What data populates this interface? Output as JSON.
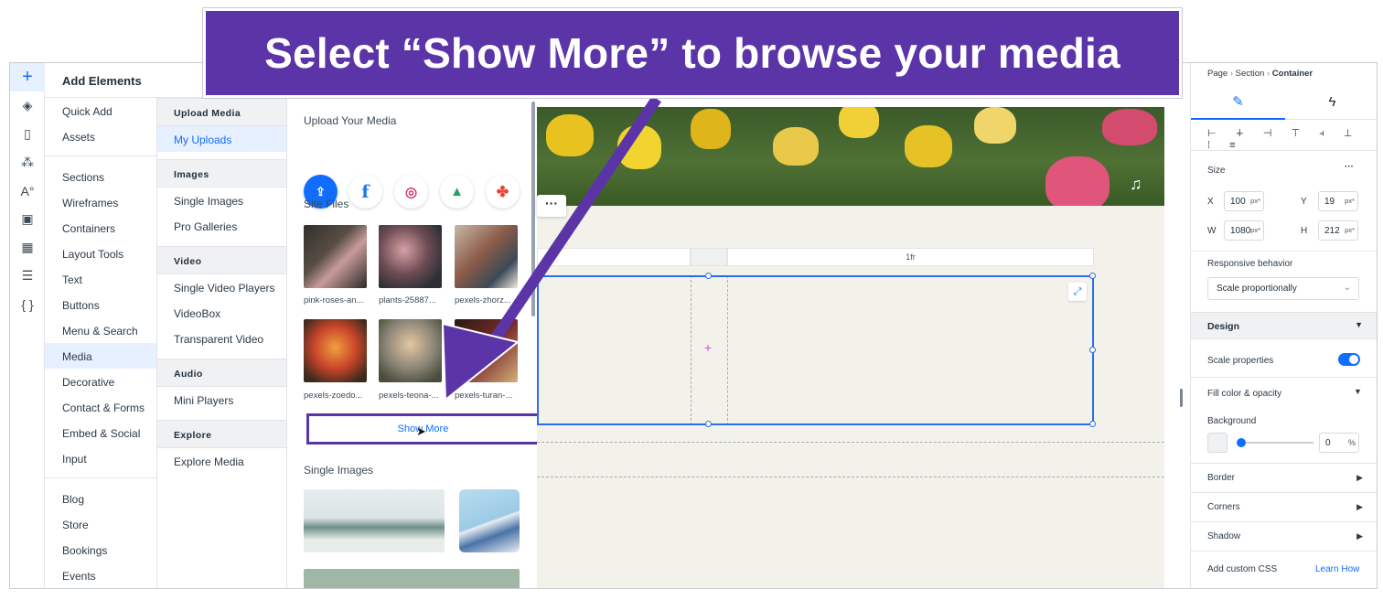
{
  "banner": {
    "text": "Select “Show More” to browse your media"
  },
  "panel": {
    "title": "Add Elements",
    "categories_top": [
      "Quick Add",
      "Assets"
    ],
    "categories_mid": [
      "Sections",
      "Wireframes",
      "Containers",
      "Layout Tools",
      "Text",
      "Buttons",
      "Menu & Search",
      "Media",
      "Decorative",
      "Contact & Forms",
      "Embed & Social",
      "Input"
    ],
    "categories_bottom": [
      "Blog",
      "Store",
      "Bookings",
      "Events"
    ],
    "active_category": "Media"
  },
  "subpanel": {
    "upload_header": "Upload Media",
    "my_uploads": "My Uploads",
    "images_header": "Images",
    "single_images": "Single Images",
    "pro_galleries": "Pro Galleries",
    "video_header": "Video",
    "single_video": "Single Video Players",
    "videobox": "VideoBox",
    "transparent_video": "Transparent Video",
    "audio_header": "Audio",
    "mini_players": "Mini Players",
    "explore_header": "Explore",
    "explore_media": "Explore Media"
  },
  "media": {
    "upload_title": "Upload Your Media",
    "site_files_title": "Site Files",
    "files": [
      {
        "name": "pink-roses-an...",
        "color": "#3d3a34"
      },
      {
        "name": "plants-25887...",
        "color": "#5e4a4c"
      },
      {
        "name": "pexels-zhorz...",
        "color": "#8a5a48"
      },
      {
        "name": "pexels-zoedo...",
        "color": "#c9452a"
      },
      {
        "name": "pexels-teona-...",
        "color": "#8a8576"
      },
      {
        "name": "pexels-turan-...",
        "color": "#7a2a2a"
      }
    ],
    "show_more": "Show More",
    "single_images_title": "Single Images"
  },
  "canvas": {
    "column_label": "1fr"
  },
  "inspector": {
    "breadcrumb_page": "Page",
    "breadcrumb_section": "Section",
    "breadcrumb_container": "Container",
    "size_label": "Size",
    "more": "···",
    "x_label": "X",
    "x_value": "100",
    "x_unit": "px*",
    "y_label": "Y",
    "y_value": "19",
    "y_unit": "px*",
    "w_label": "W",
    "w_value": "1080",
    "w_unit": "px*",
    "h_label": "H",
    "h_value": "212",
    "h_unit": "px*",
    "responsive_label": "Responsive behavior",
    "responsive_value": "Scale proportionally",
    "design_label": "Design",
    "scale_props_label": "Scale properties",
    "fill_label": "Fill color & opacity",
    "background_label": "Background",
    "opacity_value": "0",
    "opacity_unit": "%",
    "border_label": "Border",
    "corners_label": "Corners",
    "shadow_label": "Shadow",
    "custom_css_label": "Add custom CSS",
    "learn_how": "Learn How"
  },
  "colors": {
    "accent": "#116dff",
    "callout": "#5b35a8"
  }
}
